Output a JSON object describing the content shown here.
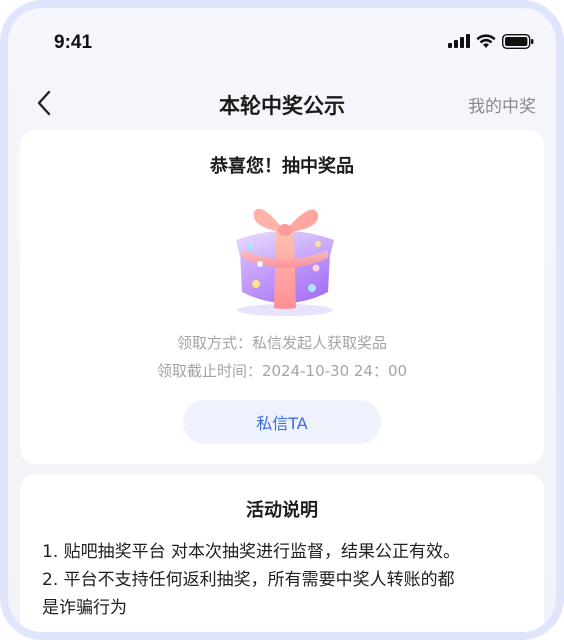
{
  "status_bar": {
    "time": "9:41"
  },
  "nav": {
    "title": "本轮中奖公示",
    "right_link": "我的中奖"
  },
  "prize_card": {
    "heading": "恭喜您！抽中奖品",
    "claim_method": "领取方式：私信发起人获取奖品",
    "claim_deadline": "领取截止时间：2024-10-30 24：00",
    "message_button": "私信TA"
  },
  "rules_card": {
    "heading": "活动说明",
    "items": [
      "1. 贴吧抽奖平台 对本次抽奖进行监督，结果公正有效。",
      "2. 平台不支持任何返利抽奖，所有需要中奖人转账的都",
      "是诈骗行为"
    ]
  },
  "colors": {
    "accent": "#3d6ee0",
    "button_bg": "#eef2fd",
    "frame_border": "#dfe5fb"
  },
  "icons": [
    "back-chevron-icon",
    "signal-icon",
    "wifi-icon",
    "battery-icon",
    "gift-box-icon"
  ]
}
